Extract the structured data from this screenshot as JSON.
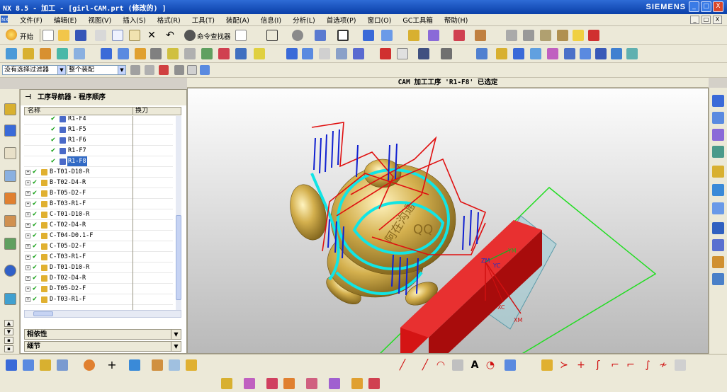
{
  "window": {
    "title": "NX 8.5 - 加工 - [girl-CAM.prt (修改的) ]",
    "brand": "SIEMENS",
    "minimize": "_",
    "maximize": "□",
    "close": "X"
  },
  "menu": [
    "文件(F)",
    "编辑(E)",
    "视图(V)",
    "插入(S)",
    "格式(R)",
    "工具(T)",
    "装配(A)",
    "信息(I)",
    "分析(L)",
    "首选项(P)",
    "窗口(O)",
    "GC工具箱",
    "帮助(H)"
  ],
  "toolbar": {
    "start_label": "开始",
    "command_finder_label": "命令查找器"
  },
  "filters": {
    "selection_filter": "没有选择过滤器",
    "assembly_scope": "整个装配"
  },
  "status": "CAM 加工工序 'R1-F8' 已选定",
  "navigator": {
    "title": "工序导航器 - 程序顺序",
    "columns": [
      "名称",
      "换刀"
    ],
    "rows": [
      {
        "name": "R1-F4",
        "level": 2,
        "expand": false,
        "selected": false
      },
      {
        "name": "R1-F5",
        "level": 2,
        "expand": false,
        "selected": false
      },
      {
        "name": "R1-F6",
        "level": 2,
        "expand": false,
        "selected": false
      },
      {
        "name": "R1-F7",
        "level": 2,
        "expand": false,
        "selected": false
      },
      {
        "name": "R1-F8",
        "level": 2,
        "expand": false,
        "selected": true
      },
      {
        "name": "B-T01-D10-R",
        "level": 1,
        "expand": true,
        "selected": false
      },
      {
        "name": "B-T02-D4-R",
        "level": 1,
        "expand": true,
        "selected": false
      },
      {
        "name": "B-T05-D2-F",
        "level": 1,
        "expand": true,
        "selected": false
      },
      {
        "name": "B-T03-R1-F",
        "level": 1,
        "expand": true,
        "selected": false
      },
      {
        "name": "C-T01-D10-R",
        "level": 1,
        "expand": true,
        "selected": false
      },
      {
        "name": "C-T02-D4-R",
        "level": 1,
        "expand": true,
        "selected": false
      },
      {
        "name": "C-T04-D0.1-F",
        "level": 1,
        "expand": true,
        "selected": false
      },
      {
        "name": "C-T05-D2-F",
        "level": 1,
        "expand": true,
        "selected": false
      },
      {
        "name": "C-T03-R1-F",
        "level": 1,
        "expand": true,
        "selected": false
      },
      {
        "name": "D-T01-D10-R",
        "level": 1,
        "expand": true,
        "selected": false
      },
      {
        "name": "D-T02-D4-R",
        "level": 1,
        "expand": true,
        "selected": false
      },
      {
        "name": "D-T05-D2-F",
        "level": 1,
        "expand": true,
        "selected": false
      },
      {
        "name": "D-T03-R1-F",
        "level": 1,
        "expand": true,
        "selected": false
      }
    ],
    "dependencies_label": "相依性",
    "details_label": "细节"
  },
  "viewport": {
    "part_text": "阿在沟通",
    "part_text2": "QQ",
    "axis_labels": {
      "ym": "YM",
      "yc": "YC",
      "zm": "ZM",
      "xc": "XC",
      "xm": "XM"
    }
  },
  "colors": {
    "titlebar": "#0a3fa8",
    "part_gold": "#c9a94b",
    "toolpath_cyan": "#11e5e5",
    "toolpath_red": "#e01010",
    "toolpath_blue": "#1020d0",
    "fixture_red": "#d41414",
    "boundary_green": "#22dd22",
    "selection": "#316ac5"
  }
}
